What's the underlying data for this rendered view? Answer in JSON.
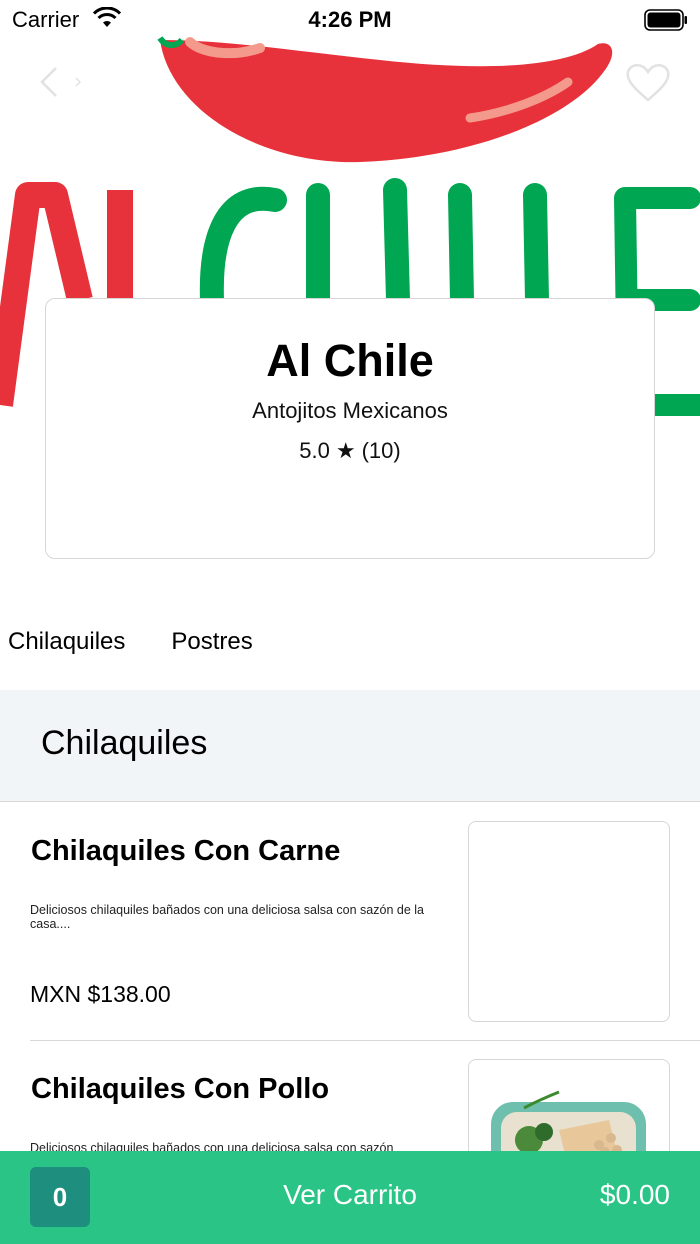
{
  "status_bar": {
    "carrier": "Carrier",
    "time": "4:26 PM",
    "icons": [
      "wifi-icon",
      "battery-icon"
    ]
  },
  "restaurant": {
    "name": "Al Chile",
    "category": "Antojitos Mexicanos",
    "rating": "5.0",
    "rating_icon": "star-icon",
    "reviews": "(10)"
  },
  "tabs": [
    {
      "label": "Chilaquiles"
    },
    {
      "label": "Postres"
    }
  ],
  "section": {
    "title": "Chilaquiles"
  },
  "items": [
    {
      "name": "Chilaquiles Con Carne",
      "description": "Deliciosos chilaquiles bañados con una deliciosa salsa con sazón de la casa....",
      "price": "MXN $138.00"
    },
    {
      "name": "Chilaquiles Con Pollo",
      "description": "Deliciosos chilaquiles bañados con una deliciosa salsa con sazón",
      "price": ""
    }
  ],
  "cart": {
    "count": "0",
    "label": "Ver Carrito",
    "total": "$0.00"
  },
  "colors": {
    "accent_green": "#2bc487",
    "cart_count_bg": "#1e8e7e",
    "logo_red": "#e8323b",
    "logo_green": "#00a651",
    "section_bg": "#f1f5f7"
  }
}
